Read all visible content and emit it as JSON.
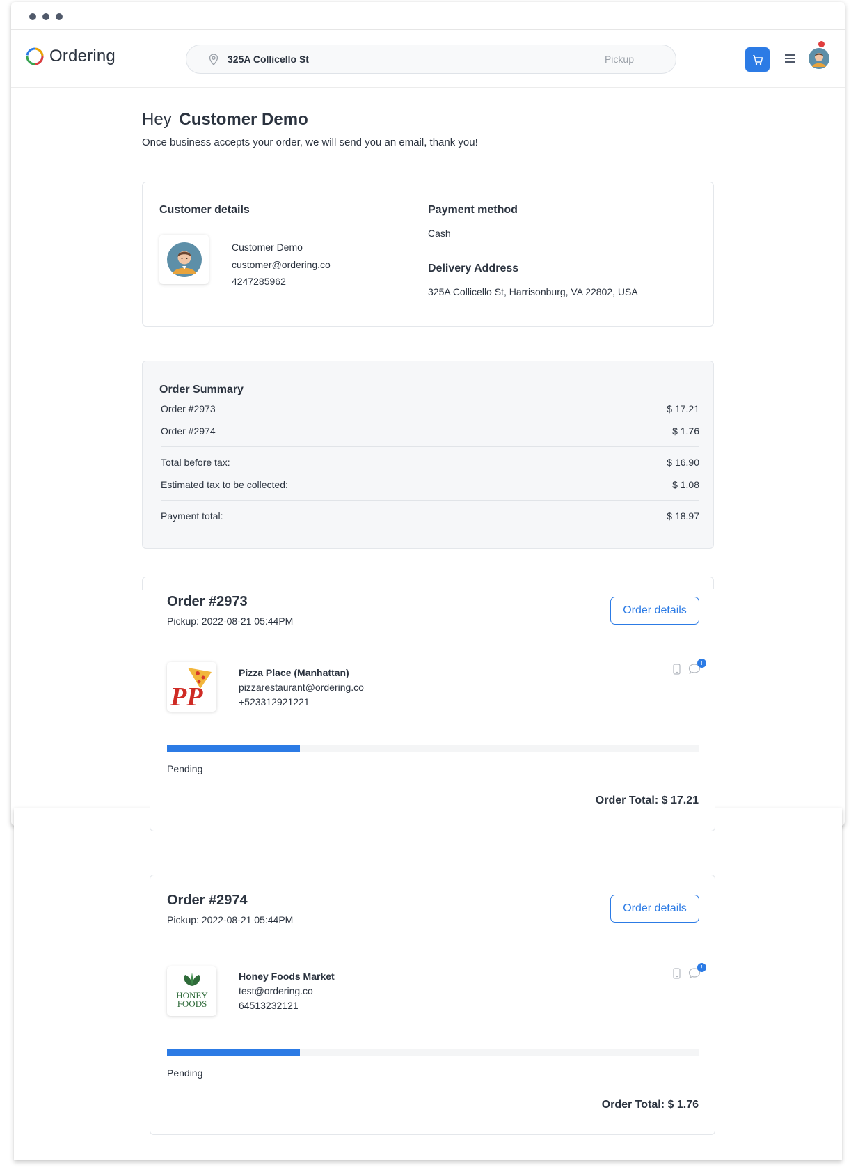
{
  "brand": {
    "name": "Ordering",
    "accent": "#2c7be5",
    "notification_color": "#e03e3e"
  },
  "header": {
    "address": "325A Collicello St",
    "order_type": "Pickup",
    "icons": [
      "location-pin-icon",
      "cart-icon",
      "hamburger-menu-icon",
      "user-avatar"
    ]
  },
  "greeting": {
    "hey": "Hey",
    "name": "Customer Demo",
    "message": "Once business accepts your order, we will send you an email, thank you!"
  },
  "customer_details": {
    "title": "Customer details",
    "name": "Customer Demo",
    "email": "customer@ordering.co",
    "phone": "4247285962"
  },
  "payment": {
    "title": "Payment method",
    "value": "Cash"
  },
  "delivery": {
    "title": "Delivery Address",
    "value": "325A Collicello St, Harrisonburg, VA 22802, USA"
  },
  "summary": {
    "title": "Order Summary",
    "orders": [
      {
        "label": "Order #2973",
        "amount": "$ 17.21"
      },
      {
        "label": "Order #2974",
        "amount": "$ 1.76"
      }
    ],
    "totals": [
      {
        "label": "Total before tax:",
        "amount": "$ 16.90"
      },
      {
        "label": "Estimated tax to be collected:",
        "amount": "$ 1.08"
      }
    ],
    "payment_total": {
      "label": "Payment total:",
      "amount": "$ 18.97"
    }
  },
  "orders": [
    {
      "title": "Order #2973",
      "pickup": "Pickup: 2022-08-21 05:44PM",
      "details_label": "Order details",
      "business": {
        "name": "Pizza Place (Manhattan)",
        "email": "pizzarestaurant@ordering.co",
        "phone": "+523312921221",
        "logo_text": "PP"
      },
      "progress": 0.25,
      "status": "Pending",
      "total": "Order Total: $ 17.21",
      "chat_badge": "!"
    },
    {
      "title": "Order #2974",
      "pickup": "Pickup: 2022-08-21 05:44PM",
      "details_label": "Order details",
      "business": {
        "name": "Honey Foods Market",
        "email": "test@ordering.co",
        "phone": "64513232121",
        "logo_text_1": "HONEY",
        "logo_text_2": "FOODS"
      },
      "progress": 0.25,
      "status": "Pending",
      "total": "Order Total: $ 1.76",
      "chat_badge": "!"
    }
  ]
}
